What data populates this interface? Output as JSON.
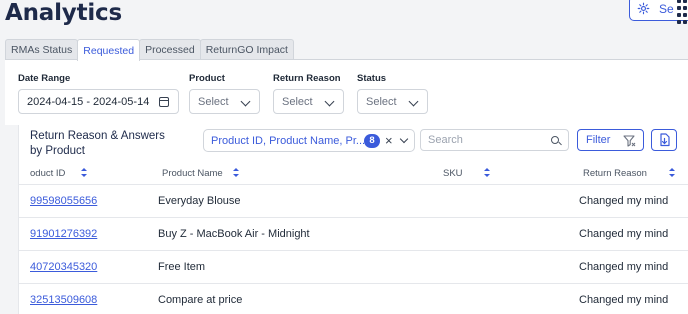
{
  "page": {
    "title": "Analytics"
  },
  "header": {
    "settings_label": "Se"
  },
  "tabs": [
    {
      "label": "RMAs Status"
    },
    {
      "label": "Requested",
      "active": true
    },
    {
      "label": "Processed"
    },
    {
      "label": "ReturnGO Impact"
    }
  ],
  "filters": {
    "date_range": {
      "label": "Date Range",
      "value": "2024-04-15 - 2024-05-14"
    },
    "product": {
      "label": "Product",
      "value": "Select"
    },
    "return_reason": {
      "label": "Return Reason",
      "value": "Select"
    },
    "status": {
      "label": "Status",
      "value": "Select"
    }
  },
  "card": {
    "title": "Return Reason & Answers by Product",
    "columns_chip": {
      "text": "Product ID, Product Name, Pr...",
      "count": "8",
      "clear": "×"
    },
    "search_placeholder": "Search",
    "filter_label": "Filter"
  },
  "table": {
    "headers": [
      "oduct ID",
      "Product Name",
      "SKU",
      "Return Reason"
    ],
    "rows": [
      {
        "product_id": "99598055656",
        "product_name": "Everyday Blouse",
        "sku": "",
        "return_reason": "Changed my mind"
      },
      {
        "product_id": "91901276392",
        "product_name": "Buy Z - MacBook Air - Midnight",
        "sku": "",
        "return_reason": "Changed my mind"
      },
      {
        "product_id": "40720345320",
        "product_name": "Free Item",
        "sku": "",
        "return_reason": "Changed my mind"
      },
      {
        "product_id": "32513509608",
        "product_name": "Compare at price",
        "sku": "",
        "return_reason": "Changed my mind"
      }
    ]
  },
  "colors": {
    "accent": "#3b5bdb",
    "title": "#1e2a4a"
  },
  "icons": [
    "gear-icon",
    "drag-handle-icon",
    "calendar-icon",
    "chevron-down-icon",
    "close-icon",
    "search-icon",
    "filter-icon",
    "export-icon",
    "sort-icon"
  ]
}
